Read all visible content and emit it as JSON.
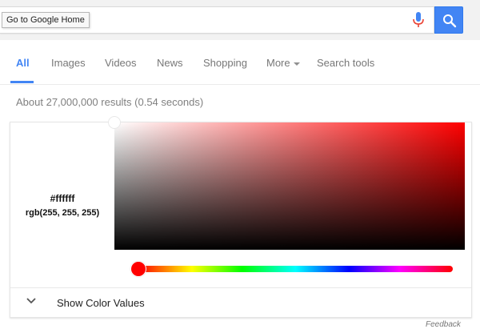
{
  "search": {
    "query": "",
    "tooltip": "Go to Google Home",
    "mic_icon": "mic-icon",
    "search_icon": "search-icon"
  },
  "tabs": [
    {
      "label": "All",
      "active": true
    },
    {
      "label": "Images"
    },
    {
      "label": "Videos"
    },
    {
      "label": "News"
    },
    {
      "label": "Shopping"
    },
    {
      "label": "More"
    },
    {
      "label": "Search tools"
    }
  ],
  "results": {
    "stats": "About 27,000,000 results (0.54 seconds)"
  },
  "color_picker": {
    "hex": "#ffffff",
    "rgb": "rgb(255, 255, 255)",
    "selected_hue_color": "#ff0000",
    "show_values_label": "Show Color Values",
    "chevron_icon": "chevron-down-icon"
  },
  "footer": {
    "feedback": "Feedback"
  },
  "colors": {
    "accent": "#4285f4",
    "mic_blue": "#4285f4",
    "mic_red": "#ea4335"
  }
}
